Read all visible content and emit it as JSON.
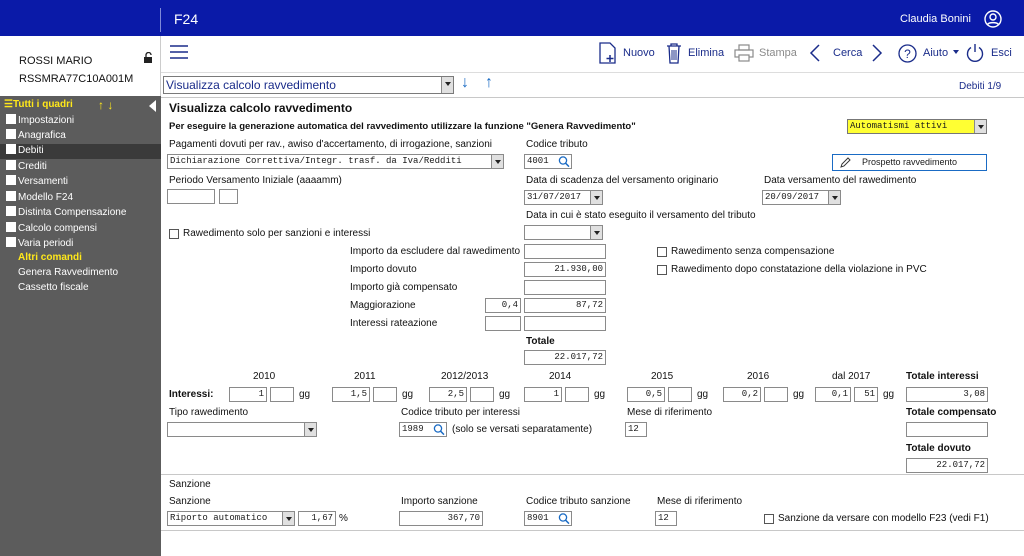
{
  "topbar": {
    "app_title": "F24",
    "user_name": "Claudia Bonini"
  },
  "sidebar": {
    "person_name": "ROSSI MARIO",
    "fiscal_code": "RSSMRA77C10A001M",
    "all_frames": "Tutti i quadri",
    "items": [
      "Impostazioni",
      "Anagrafica",
      "Debiti",
      "Crediti",
      "Versamenti",
      "Modello F24",
      "Distinta Compensazione",
      "Calcolo compensi",
      "Varia periodi"
    ],
    "other_commands": "Altri comandi",
    "commands": [
      "Genera Ravvedimento",
      "Cassetto fiscale"
    ]
  },
  "toolbar": {
    "new": "Nuovo",
    "delete": "Elimina",
    "print": "Stampa",
    "search": "Cerca",
    "help": "Aiuto",
    "exit": "Esci"
  },
  "nav": {
    "view_select": "Visualizza calcolo ravvedimento",
    "page_counter": "Debiti 1/9"
  },
  "form": {
    "title": "Visualizza calcolo ravvedimento",
    "instruction": "Per eseguire la generazione automatica del ravvedimento utilizzare la funzione \"Genera Ravvedimento\"",
    "automation_select": "Automatismi attivi",
    "payments_label": "Pagamenti dovuti per rav., awiso d'accertamento, di irrogazione, sanzioni",
    "payments_value": "Dichiarazione Correttiva/Integr. trasf. da Iva/Redditi",
    "tax_code_label": "Codice tributo",
    "tax_code_value": "4001",
    "schema_button": "Prospetto ravvedimento",
    "initial_period_label": "Periodo Versamento Iniziale (aaaamm)",
    "due_date_label": "Data di scadenza del versamento originario",
    "due_date_value": "31/07/2017",
    "payment_date_label": "Data versamento del rawedimento",
    "payment_date_value": "20/09/2017",
    "executed_date_label": "Data in cui è stato eseguito il versamento del tributo",
    "only_sanctions_label": "Rawedimento solo per sanzioni e interessi",
    "exclude_label": "Importo da escludere dal rawedimento",
    "amount_due_label": "Importo dovuto",
    "amount_due_value": "21.930,00",
    "compensated_label": "Importo già compensato",
    "surcharge_label": "Maggiorazione",
    "surcharge_rate": "0,4",
    "surcharge_value": "87,72",
    "installment_interest_label": "Interessi rateazione",
    "total_label": "Totale",
    "total_value": "22.017,72",
    "no_compensation_label": "Rawedimento senza compensazione",
    "after_violation_label": "Rawedimento dopo constatazione della violazione in PVC"
  },
  "interests": {
    "label": "Interessi:",
    "gg": "gg",
    "years": [
      {
        "year": "2010",
        "rate": "1",
        "days": ""
      },
      {
        "year": "2011",
        "rate": "1,5",
        "days": ""
      },
      {
        "year": "2012/2013",
        "rate": "2,5",
        "days": ""
      },
      {
        "year": "2014",
        "rate": "1",
        "days": ""
      },
      {
        "year": "2015",
        "rate": "0,5",
        "days": ""
      },
      {
        "year": "2016",
        "rate": "0,2",
        "days": ""
      },
      {
        "year": "dal 2017",
        "rate": "0,1",
        "days": "51"
      }
    ],
    "total_interest_label": "Totale interessi",
    "total_interest_value": "3,08",
    "total_compensated_label": "Totale compensato",
    "total_due_label": "Totale dovuto",
    "total_due_value": "22.017,72",
    "type_label": "Tipo rawedimento",
    "interest_code_label": "Codice tributo per interessi",
    "interest_code_value": "1989",
    "separately_note": "(solo se versati separatamente)",
    "ref_month_label": "Mese di riferimento",
    "ref_month_value": "12"
  },
  "sanction": {
    "section_title": "Sanzione",
    "label": "Sanzione",
    "select_value": "Riporto automatico",
    "rate": "1,67",
    "percent": "%",
    "amount_label": "Importo sanzione",
    "amount_value": "367,70",
    "code_label": "Codice tributo sanzione",
    "code_value": "8901",
    "ref_month_label": "Mese di riferimento",
    "ref_month_value": "12",
    "f23_label": "Sanzione da versare con modello F23 (vedi F1)"
  }
}
